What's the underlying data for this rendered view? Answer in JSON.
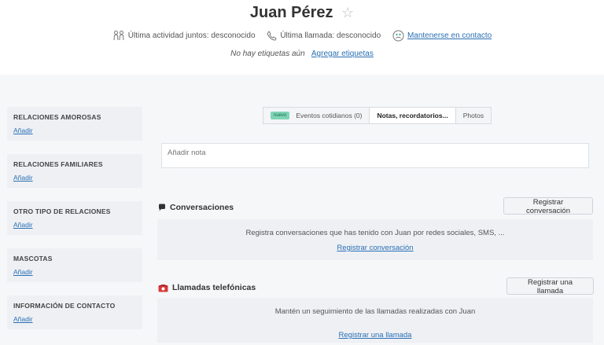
{
  "contact": {
    "name": "Juan Pérez"
  },
  "meta": {
    "last_activity": "Última actividad juntos: desconocido",
    "last_call": "Última llamada: desconocido",
    "stay_in_touch": "Mantenerse en contacto"
  },
  "tags": {
    "empty_text": "No hay etiquetas aún",
    "add_label": "Agregar etiquetas"
  },
  "sidebar": {
    "sections": [
      {
        "title": "RELACIONES AMOROSAS",
        "add": "Añadir"
      },
      {
        "title": "RELACIONES FAMILIARES",
        "add": "Añadir"
      },
      {
        "title": "OTRO TIPO DE RELACIONES",
        "add": "Añadir"
      },
      {
        "title": "MASCOTAS",
        "add": "Añadir"
      },
      {
        "title": "INFORMACIÓN DE CONTACTO",
        "add": "Añadir"
      }
    ]
  },
  "tabs": {
    "new_badge": "nuevo",
    "items": [
      {
        "label": "Eventos cotidianos (0)"
      },
      {
        "label": "Notas, recordatorios..."
      },
      {
        "label": "Photos"
      }
    ],
    "active_index": 1
  },
  "note": {
    "placeholder": "Añadir nota"
  },
  "conversations": {
    "title": "Conversaciones",
    "button": "Registrar conversación",
    "description": "Registra conversaciones que has tenido con Juan por redes sociales, SMS, ...",
    "link": "Registrar conversación"
  },
  "calls": {
    "title": "Llamadas telefónicas",
    "button": "Registrar una llamada",
    "description": "Mantén un seguimiento de las llamadas realizadas con Juan",
    "link": "Registrar una llamada"
  },
  "colors": {
    "accent_link": "#2a6fb5",
    "badge_bg": "#7fd4b5",
    "panel_bg": "#eef0f4",
    "phone_icon": "#d63b3b"
  }
}
